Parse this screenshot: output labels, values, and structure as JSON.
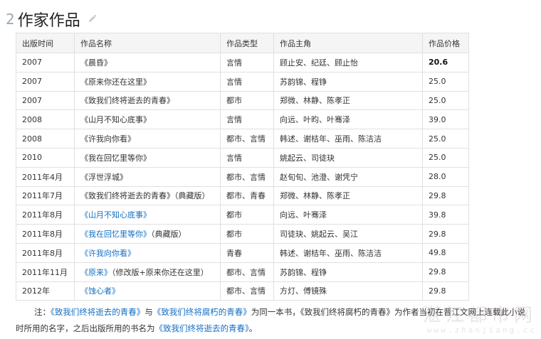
{
  "section": {
    "number": "2",
    "title": "作家作品",
    "edit_icon": "pencil-icon"
  },
  "table": {
    "headers": [
      "出版时间",
      "作品名称",
      "作品类型",
      "作品主角",
      "作品价格"
    ],
    "rows": [
      {
        "date": "2007",
        "title": "《晨昏》",
        "suffix": "",
        "linked": false,
        "genre": "言情",
        "leads": "顾止安、纪廷、顾止怡",
        "price": "20.6",
        "price_bold": true
      },
      {
        "date": "2007",
        "title": "《原来你还在这里》",
        "suffix": "",
        "linked": false,
        "genre": "言情",
        "leads": "苏韵锦、程铮",
        "price": "25.0",
        "price_bold": false
      },
      {
        "date": "2007",
        "title": "《致我们终将逝去的青春》",
        "suffix": "",
        "linked": false,
        "genre": "都市",
        "leads": "郑微、林静、陈孝正",
        "price": "25.0",
        "price_bold": false
      },
      {
        "date": "2008",
        "title": "《山月不知心底事》",
        "suffix": "",
        "linked": false,
        "genre": "言情",
        "leads": "向远、叶昀、叶骞泽",
        "price": "39.0",
        "price_bold": false
      },
      {
        "date": "2008",
        "title": "《许我向你看》",
        "suffix": "",
        "linked": false,
        "genre": "都市、言情",
        "leads": "韩述、谢桔年、巫雨、陈洁洁",
        "price": "25.0",
        "price_bold": false
      },
      {
        "date": "2010",
        "title": "《我在回忆里等你》",
        "suffix": "",
        "linked": false,
        "genre": "言情",
        "leads": "姚起云、司徒玦",
        "price": "25.0",
        "price_bold": false
      },
      {
        "date": "2011年4月",
        "title": "《浮世浮城》",
        "suffix": "",
        "linked": false,
        "genre": "都市、言情",
        "leads": "赵旬旬、池澄、谢凭宁",
        "price": "28.0",
        "price_bold": false
      },
      {
        "date": "2011年7月",
        "title": "《致我们终将逝去的青春》（典藏版）",
        "suffix": "",
        "linked": false,
        "genre": "都市、青春",
        "leads": "郑微、林静、陈孝正",
        "price": "29.8",
        "price_bold": false
      },
      {
        "date": "2011年8月",
        "title": "《山月不知心底事》",
        "suffix": "",
        "linked": true,
        "genre": "都市",
        "leads": "向远、叶骞泽",
        "price": "39.8",
        "price_bold": false
      },
      {
        "date": "2011年8月",
        "title": "《我在回忆里等你》",
        "suffix": "（典藏版）",
        "linked": true,
        "genre": "都市",
        "leads": "司徒玦、姚起云、吴江",
        "price": "29.8",
        "price_bold": false
      },
      {
        "date": "2011年8月",
        "title": "《许我向你看》",
        "suffix": "",
        "linked": true,
        "genre": "青春",
        "leads": "韩述、谢桔年、巫雨、陈洁洁",
        "price": "49.8",
        "price_bold": false
      },
      {
        "date": "2011年11月",
        "title": "《原来》",
        "suffix": "（修改版+原来你还在这里）",
        "linked": true,
        "genre": "都市、言情",
        "leads": "苏韵锦、程铮",
        "price": "29.8",
        "price_bold": false
      },
      {
        "date": "2012年",
        "title": "《蚀心者》",
        "suffix": "",
        "linked": true,
        "genre": "都市、言情",
        "leads": "方灯、傅镜殊",
        "price": "29.8",
        "price_bold": false
      }
    ]
  },
  "note": {
    "prefix": "注：",
    "link1": "《致我们终将逝去的青春》",
    "mid1": "与",
    "link2": "《致我们终将腐朽的青春》",
    "mid2": "为同一本书，《致我们终将腐朽的青春》为作者当初在晋江文网上连载此小说时所用的名字，之后出版所用的书名为",
    "link3": "《致我们终将逝去的青春》",
    "end": "。"
  },
  "watermark": {
    "text": "湛江都市网",
    "url": "www.zhanjiang.cc"
  },
  "colors": {
    "link": "#136ec2",
    "header_bg": "#f5f5f5",
    "border": "#e0e0e0",
    "section_number": "#9aa8b4"
  }
}
